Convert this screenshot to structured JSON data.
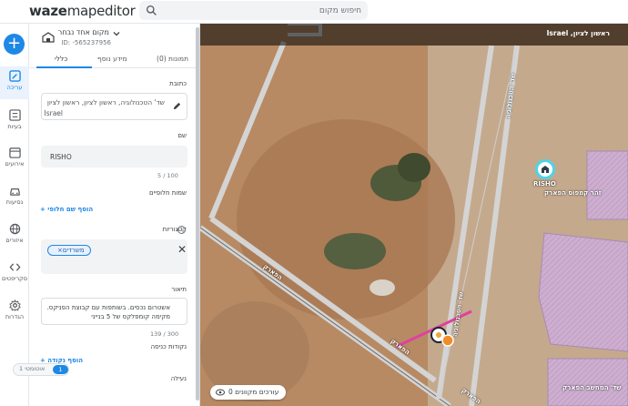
{
  "app": {
    "logo_bold": "waze",
    "logo_light": "mapeditor"
  },
  "search": {
    "placeholder": "חיפוש מקום"
  },
  "rail": {
    "add_label": "+",
    "items": [
      {
        "label": "עריכה",
        "icon": "edit-map-icon",
        "active": true
      },
      {
        "label": "בעיות",
        "icon": "issues-icon"
      },
      {
        "label": "אירועים",
        "icon": "calendar-icon"
      },
      {
        "label": "נסיעות",
        "icon": "car-icon"
      },
      {
        "label": "איזורים",
        "icon": "globe-icon"
      },
      {
        "label": "סקריפטים",
        "icon": "code-icon"
      },
      {
        "label": "הגדרות",
        "icon": "gear-icon"
      }
    ]
  },
  "panel": {
    "header": {
      "title": "מקום אחד נבחר",
      "id": "ID: -565237956"
    },
    "tabs": {
      "general": "כללי",
      "more_info": "מידע נוסף",
      "photos": "תמונות (0)"
    },
    "address": {
      "label": "כתובת",
      "line1": "שד' הטכנולוגיה, ראשון לציון, ראשון לציון",
      "line2": "Israel"
    },
    "name": {
      "label": "שם",
      "value": "RISHO",
      "counter": "5 / 100"
    },
    "alt_names": {
      "label": "שמות חלופיים",
      "link": "הוסף שם חלופי +"
    },
    "categories": {
      "label": "קטגוריות",
      "chip": "משרדים",
      "chip_remove": "×",
      "clear": "✕",
      "info": "i"
    },
    "description": {
      "label": "תיאור",
      "value": "אשטרום נכסים. בשותפות עם קבוצת הפניקס. מקימה קומפלקס של 5 בנייני",
      "counter": "139 / 300"
    },
    "entry_points": {
      "label": "נקודות כניסה",
      "link": "הוסף נקודה +"
    },
    "lock": {
      "label": "נעילה",
      "level": "1",
      "auto": "אוטומטי 1"
    }
  },
  "map": {
    "city": "Israel ,ראשון לציון",
    "streets": [
      "שד' הטכנולוגיה",
      "שד' הטכנולוגיה",
      "הפארק",
      "הפארק",
      "הפארק",
      "זהר קמפוס הפארק",
      "שד' המחשב הפארק"
    ],
    "venue_name": "RISHO",
    "editors": "עורכים מקוונים 0"
  },
  "colors": {
    "accent": "#1e88e5",
    "venue_area": "#d9b8df",
    "road_selected": "#e040a0"
  }
}
